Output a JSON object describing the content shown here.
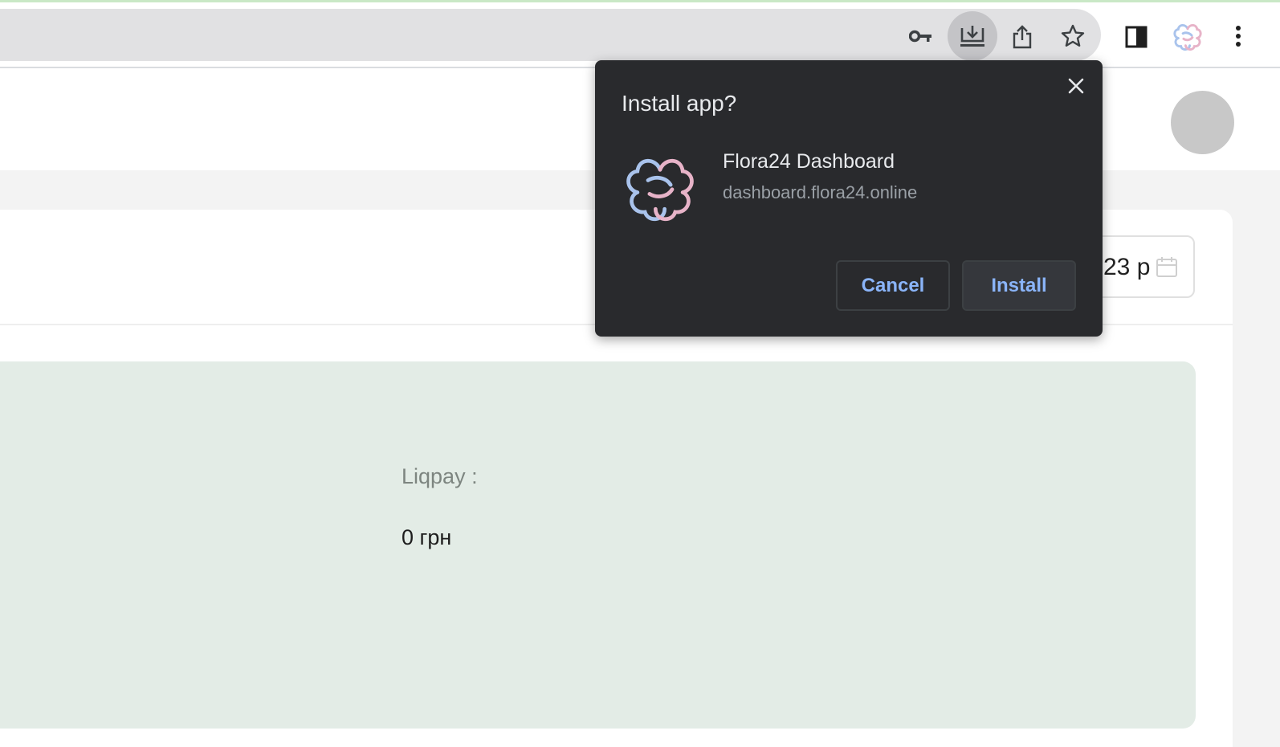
{
  "browser": {
    "toolbar_icons": [
      "key-icon",
      "install-app-icon",
      "share-icon",
      "star-icon",
      "side-panel-icon",
      "extension-icon",
      "menu-icon"
    ]
  },
  "page": {
    "date_field_value": "23 р",
    "liqpay_label": "Liqpay :",
    "liqpay_value": "0 грн"
  },
  "dialog": {
    "title": "Install app?",
    "app_name": "Flora24 Dashboard",
    "app_url": "dashboard.flora24.online",
    "cancel_label": "Cancel",
    "install_label": "Install"
  },
  "colors": {
    "dialog_bg": "#292a2d",
    "button_text": "#8ab4f8",
    "stats_panel_bg": "#e3ece6",
    "logo_blue": "#a9c3ec",
    "logo_pink": "#e7b3c8"
  }
}
